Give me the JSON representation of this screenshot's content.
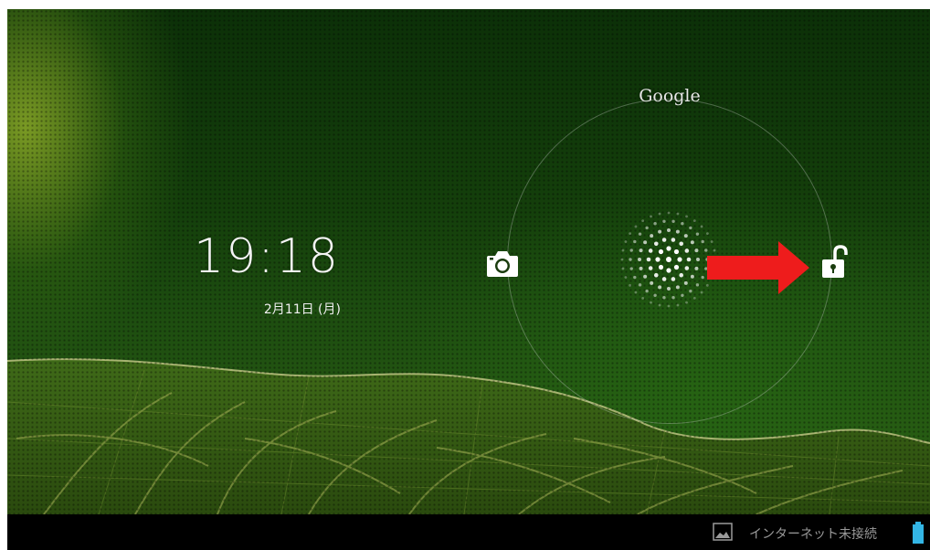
{
  "lockscreen": {
    "time": "19:18",
    "date": "2月11日 (月)",
    "search_label": "Google",
    "targets": [
      {
        "name": "camera",
        "icon": "camera-icon"
      },
      {
        "name": "unlock",
        "icon": "unlock-icon"
      }
    ],
    "annotation_color": "#ee1c1c"
  },
  "navbar": {
    "status_text": "インターネット未接続",
    "icons": [
      "image-icon",
      "battery-icon"
    ],
    "battery_color": "#33b5e5"
  }
}
